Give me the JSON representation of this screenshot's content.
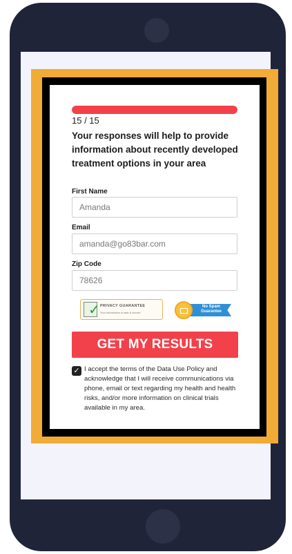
{
  "progress": {
    "text": "15 / 15",
    "fraction": 1.0
  },
  "form": {
    "headline": "Your responses will help to provide information about recently developed treatment options in your area",
    "first_name": {
      "label": "First Name",
      "value": "Amanda"
    },
    "email": {
      "label": "Email",
      "value": "amanda@go83bar.com"
    },
    "zip": {
      "label": "Zip Code",
      "value": "78626"
    },
    "submit_label": "GET MY RESULTS",
    "consent_text": "I accept the terms of the Data Use Policy and acknowledge that I will receive communications via phone, email or text regarding my health and health risks, and/or more information on clinical trials available in my area.",
    "consent_checked": true
  },
  "badges": {
    "privacy": {
      "title": "PRIVACY GUARANTEE",
      "subtitle": "Your information is safe & secure",
      "icon": "check-icon"
    },
    "no_spam": {
      "line1": "No Spam",
      "line2": "Guarantee",
      "icon": "envelope-icon"
    }
  },
  "colors": {
    "accent_red": "#f2414a",
    "frame_gold": "#f1ab36",
    "phone_body": "#1f2438",
    "spam_blue": "#2f8fd6"
  }
}
